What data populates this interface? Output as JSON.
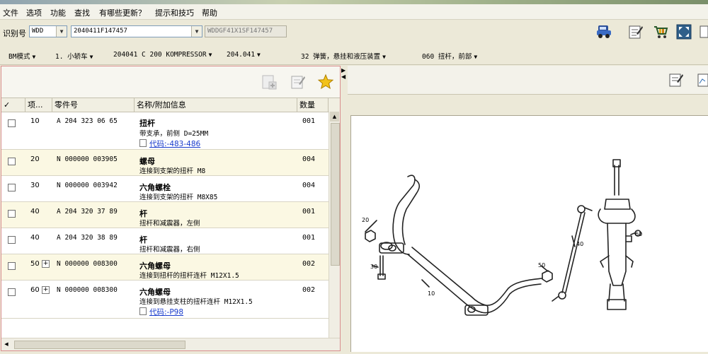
{
  "menu": [
    "文件",
    "选项",
    "功能",
    "查找",
    "有哪些更新？",
    "提示和技巧",
    "帮助"
  ],
  "id_bar": {
    "label": "识别号",
    "prefix_value": "WDD",
    "vin_value": "2040411F147457",
    "full_vin": "WDDGF41X1SF147457"
  },
  "toolbar_icons": [
    "vehicle-icon",
    "notepad-icon",
    "cart-icon",
    "fullscreen-icon",
    "more-icon"
  ],
  "breadcrumbs": [
    {
      "label": "BM模式",
      "dropdown": true
    },
    {
      "label": "1. 小轿车",
      "dropdown": true
    },
    {
      "label": "204041 C 200 KOMPRESSOR",
      "dropdown": true
    },
    {
      "label": "204.041",
      "dropdown": true
    },
    {
      "label": "32 弹簧，悬挂和液压装置",
      "dropdown": true
    },
    {
      "label": "060 扭杆，前部",
      "dropdown": true
    }
  ],
  "table": {
    "headers": {
      "check": "✓",
      "pos": "项...",
      "part": "零件号",
      "name": "名称/附加信息",
      "qty": "数量"
    },
    "rows": [
      {
        "pos": "10",
        "part": "A 204 323 06 65",
        "name": "扭杆",
        "desc": "带支承，前侧 D=25MM",
        "link": "代码:-483-486",
        "qty": "001",
        "expand": false
      },
      {
        "pos": "20",
        "part": "N 000000 003905",
        "name": "螺母",
        "desc": "连接到支架的扭杆 M8",
        "link": "",
        "qty": "004",
        "expand": false
      },
      {
        "pos": "30",
        "part": "N 000000 003942",
        "name": "六角螺栓",
        "desc": "连接到支架的扭杆 M8X85",
        "link": "",
        "qty": "004",
        "expand": false
      },
      {
        "pos": "40",
        "part": "A 204 320 37 89",
        "name": "杆",
        "desc": "扭杆和减震器，左侧",
        "link": "",
        "qty": "001",
        "expand": false
      },
      {
        "pos": "40",
        "part": "A 204 320 38 89",
        "name": "杆",
        "desc": "扭杆和减震器，右侧",
        "link": "",
        "qty": "001",
        "expand": false
      },
      {
        "pos": "50",
        "part": "N 000000 008300",
        "name": "六角螺母",
        "desc": "连接到扭杆的扭杆连杆 M12X1.5",
        "link": "",
        "qty": "002",
        "expand": true
      },
      {
        "pos": "60",
        "part": "N 000000 008300",
        "name": "六角螺母",
        "desc": "连接到悬挂支柱的扭杆连杆 M12X1.5",
        "link": "代码:-P98",
        "qty": "002",
        "expand": true
      }
    ]
  },
  "drawing_labels": [
    "20",
    "30",
    "10",
    "50",
    "40",
    "60"
  ]
}
